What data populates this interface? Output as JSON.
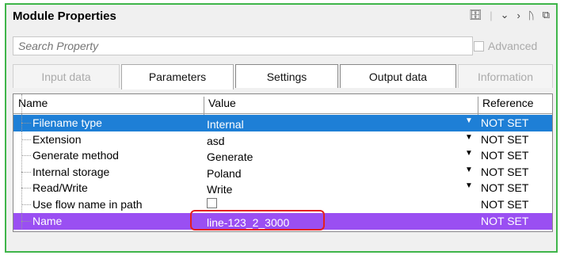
{
  "window": {
    "title": "Module Properties",
    "toolbar_icons": [
      "database-icon",
      "chevron-down-icon",
      "chevron-right-icon",
      "pin-icon",
      "float-icon"
    ]
  },
  "search": {
    "placeholder": "Search Property"
  },
  "advanced": {
    "label": "Advanced",
    "checked": false
  },
  "tabs": [
    {
      "label": "Input data",
      "enabled": false
    },
    {
      "label": "Parameters",
      "enabled": true,
      "active": true
    },
    {
      "label": "Settings",
      "enabled": true
    },
    {
      "label": "Output data",
      "enabled": true
    },
    {
      "label": "Information",
      "enabled": false
    }
  ],
  "grid": {
    "headers": {
      "name": "Name",
      "value": "Value",
      "reference": "Reference"
    },
    "rows": [
      {
        "name": "Filename type",
        "value": "Internal",
        "dropdown": true,
        "reference": "NOT SET",
        "state": "selected-blue"
      },
      {
        "name": "Extension",
        "value": "asd",
        "dropdown": true,
        "reference": "NOT SET"
      },
      {
        "name": "Generate method",
        "value": "Generate",
        "dropdown": true,
        "reference": "NOT SET"
      },
      {
        "name": "Internal storage",
        "value": "Poland",
        "dropdown": true,
        "reference": "NOT SET"
      },
      {
        "name": "Read/Write",
        "value": "Write",
        "dropdown": true,
        "reference": "NOT SET"
      },
      {
        "name": "Use flow name in path",
        "value_checkbox": false,
        "reference": "NOT SET"
      },
      {
        "name": "Name",
        "value": "line-123_2_3000",
        "reference": "NOT SET",
        "state": "selected-purple",
        "highlighted": true
      }
    ]
  },
  "colors": {
    "window_border": "#3fb54a",
    "selected_blue": "#1e7fd6",
    "selected_purple": "#9a4ff2",
    "highlight": "#e32020"
  }
}
